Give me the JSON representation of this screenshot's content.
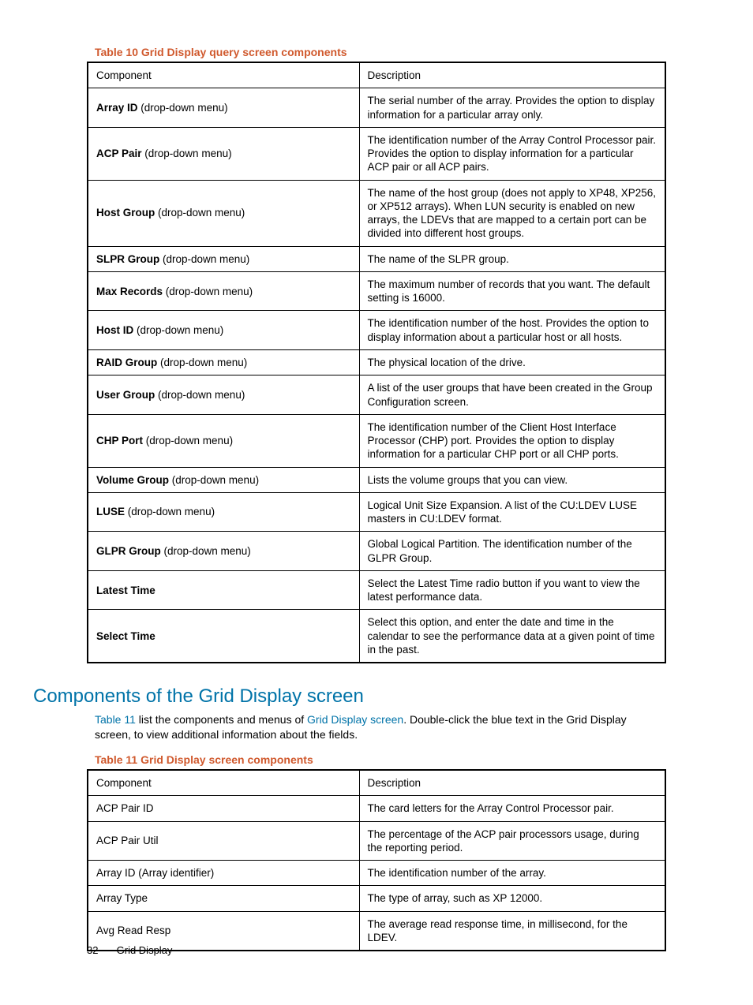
{
  "table10": {
    "caption": "Table 10 Grid Display query screen components",
    "header": {
      "component": "Component",
      "description": "Description"
    },
    "rows": [
      {
        "bold": "Array ID",
        "note": " (drop-down menu)",
        "desc": "The serial number of the array. Provides the option to display information for a particular array only."
      },
      {
        "bold": "ACP Pair",
        "note": " (drop-down menu)",
        "desc": "The identification number of the Array Control Processor pair. Provides the option to display information for a particular ACP pair or all ACP pairs."
      },
      {
        "bold": "Host Group",
        "note": " (drop-down menu)",
        "desc": "The name of the host group (does not apply to XP48, XP256, or XP512 arrays). When LUN security is enabled on new arrays, the LDEVs that are mapped to a certain port can be divided into different host groups."
      },
      {
        "bold": "SLPR Group",
        "note": " (drop-down menu)",
        "desc": "The name of the SLPR group."
      },
      {
        "bold": "Max Records",
        "note": " (drop-down menu)",
        "desc": "The maximum number of records that you want. The default setting is 16000."
      },
      {
        "bold": "Host ID",
        "note": " (drop-down menu)",
        "desc": "The identification number of the host. Provides the option to display information about a particular host or all hosts."
      },
      {
        "bold": "RAID Group",
        "note": " (drop-down menu)",
        "desc": "The physical location of the drive."
      },
      {
        "bold": "User Group",
        "note": " (drop-down menu)",
        "desc": "A list of the user groups that have been created in the Group Configuration screen."
      },
      {
        "bold": "CHP Port",
        "note": " (drop-down menu)",
        "desc": "The identification number of the Client Host Interface Processor (CHP) port. Provides the option to display information for a particular CHP port or all CHP ports."
      },
      {
        "bold": "Volume Group",
        "note": " (drop-down menu)",
        "desc": "Lists the volume groups that you can view."
      },
      {
        "bold": "LUSE",
        "note": " (drop-down menu)",
        "desc": "Logical Unit Size Expansion. A list of the CU:LDEV LUSE masters in CU:LDEV format."
      },
      {
        "bold": "GLPR Group",
        "note": " (drop-down menu)",
        "desc": "Global Logical Partition. The identification number of the GLPR Group."
      },
      {
        "bold": "Latest Time",
        "note": "",
        "desc": "Select the Latest Time radio button if you want to view the latest performance data."
      },
      {
        "bold": "Select Time",
        "note": "",
        "desc": "Select this option, and enter the date and time in the calendar to see the performance data at a given point of time in the past."
      }
    ]
  },
  "section": {
    "heading": "Components of the Grid Display screen",
    "para_pre": "",
    "para": {
      "link1": "Table 11",
      "mid1": " list the components and menus of ",
      "link2": "Grid Display screen",
      "mid2": ". Double-click the blue text in the Grid Display screen, to view additional information about the fields."
    }
  },
  "table11": {
    "caption": "Table 11 Grid Display screen components",
    "header": {
      "component": "Component",
      "description": "Description"
    },
    "rows": [
      {
        "comp": "ACP Pair ID",
        "desc": "The card letters for the Array Control Processor pair."
      },
      {
        "comp": "ACP Pair Util",
        "desc": "The percentage of the ACP pair processors usage, during the reporting period."
      },
      {
        "comp": "Array ID (Array identifier)",
        "desc": "The identification number of the array."
      },
      {
        "comp": "Array Type",
        "desc": "The type of array, such as XP 12000."
      },
      {
        "comp": "Avg Read Resp",
        "desc": "The average read response time, in millisecond, for the LDEV."
      }
    ]
  },
  "footer": {
    "page": "32",
    "title": "Grid Display"
  }
}
